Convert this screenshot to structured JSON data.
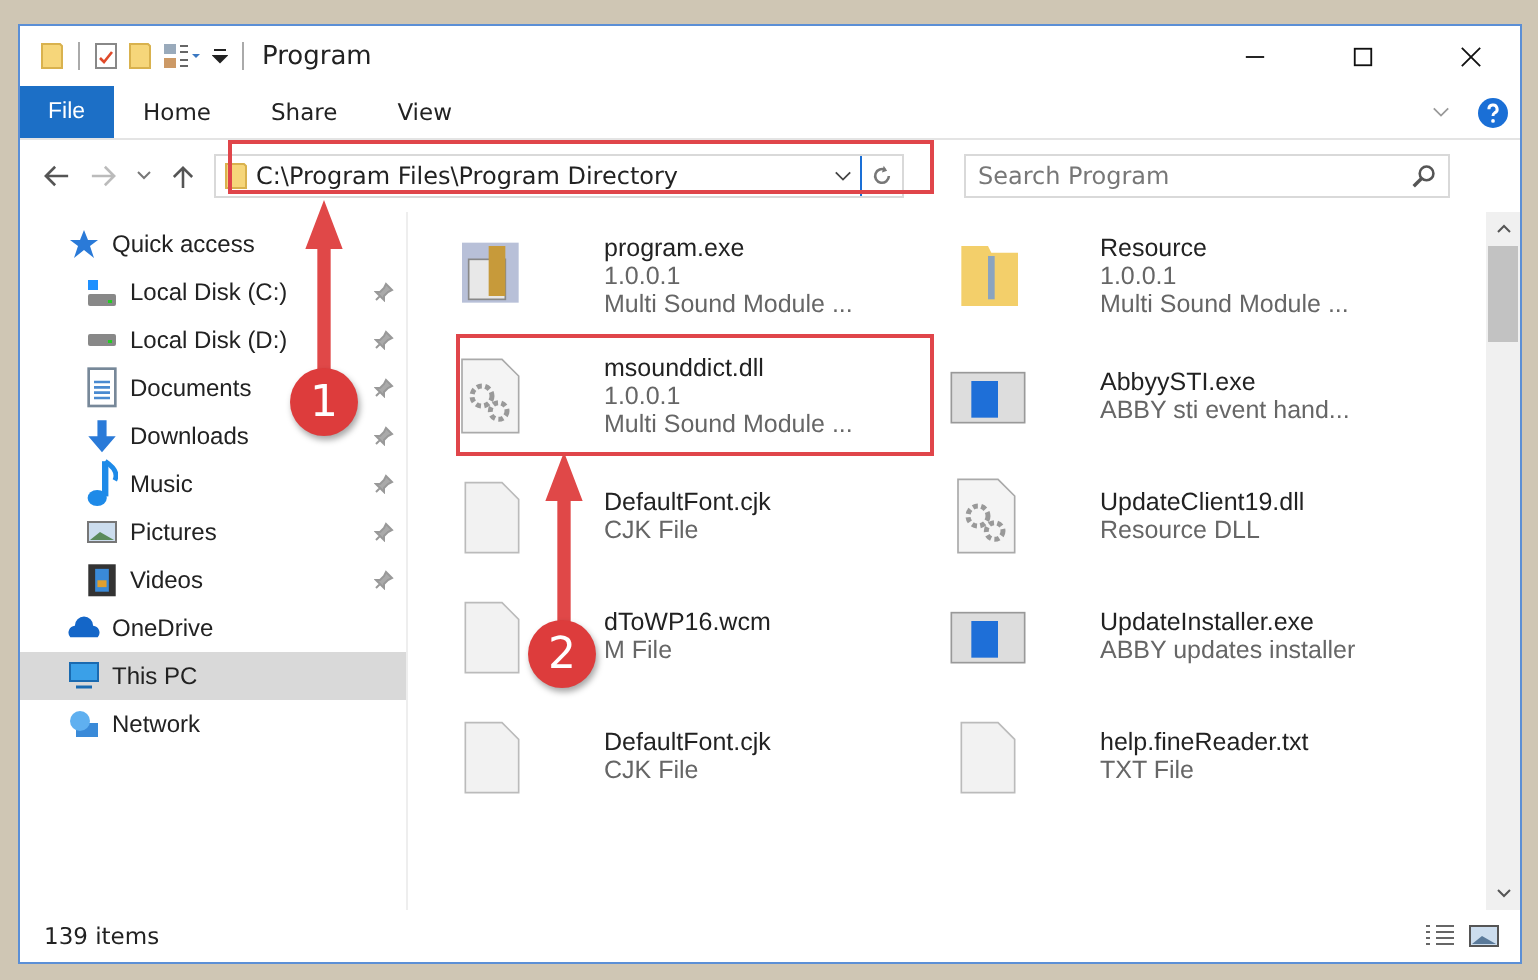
{
  "window": {
    "title": "Program"
  },
  "ribbon_tabs": [
    {
      "label": "File",
      "kind": "file"
    },
    {
      "label": "Home",
      "kind": "plain"
    },
    {
      "label": "Share",
      "kind": "plain"
    },
    {
      "label": "View",
      "kind": "plain"
    }
  ],
  "address": {
    "path": "C:\\Program Files\\Program Directory"
  },
  "search": {
    "placeholder": "Search Program"
  },
  "sidebar": {
    "items": [
      {
        "label": "Quick access",
        "kind": "star",
        "selected": false,
        "children": [
          {
            "label": "Local Disk (C:)",
            "kind": "winDrive",
            "pinned": true,
            "selected": false
          },
          {
            "label": "Local Disk (D:)",
            "kind": "drive",
            "pinned": true,
            "selected": false
          },
          {
            "label": "Documents",
            "kind": "docs",
            "pinned": true,
            "selected": false
          },
          {
            "label": "Downloads",
            "kind": "download",
            "pinned": true,
            "selected": false
          },
          {
            "label": "Music",
            "kind": "music",
            "pinned": true,
            "selected": false
          },
          {
            "label": "Pictures",
            "kind": "pictures",
            "pinned": true,
            "selected": false
          },
          {
            "label": "Videos",
            "kind": "videos",
            "pinned": true,
            "selected": false
          }
        ]
      },
      {
        "label": "OneDrive",
        "kind": "cloud",
        "selected": false
      },
      {
        "label": "This PC",
        "kind": "pc",
        "selected": true
      },
      {
        "label": "Network",
        "kind": "network",
        "selected": false
      }
    ]
  },
  "files": [
    {
      "kind": "installer",
      "name": "program.exe",
      "lines": [
        "1.0.0.1",
        "Multi Sound Module ..."
      ]
    },
    {
      "kind": "folder",
      "name": "Resource",
      "lines": [
        "1.0.0.1",
        "Multi Sound Module ..."
      ]
    },
    {
      "kind": "dll",
      "name": "msounddict.dll",
      "lines": [
        "1.0.0.1",
        "Multi Sound Module ..."
      ]
    },
    {
      "kind": "app",
      "name": "AbbyySTI.exe",
      "lines": [
        "ABBY sti event hand..."
      ]
    },
    {
      "kind": "doc",
      "name": "DefaultFont.cjk",
      "lines": [
        "CJK File"
      ]
    },
    {
      "kind": "dll",
      "name": "UpdateClient19.dll",
      "lines": [
        "Resource DLL"
      ]
    },
    {
      "kind": "doc",
      "name": "dToWP16.wcm",
      "lines": [
        "M File"
      ]
    },
    {
      "kind": "app",
      "name": "UpdateInstaller.exe",
      "lines": [
        "ABBY updates installer"
      ]
    },
    {
      "kind": "doc",
      "name": "DefaultFont.cjk",
      "lines": [
        "CJK File"
      ]
    },
    {
      "kind": "doc",
      "name": "help.fineReader.txt",
      "lines": [
        "TXT File"
      ]
    }
  ],
  "status_bar": {
    "count": "139 items"
  },
  "annotations": [
    {
      "label": "1"
    },
    {
      "label": "2"
    }
  ]
}
